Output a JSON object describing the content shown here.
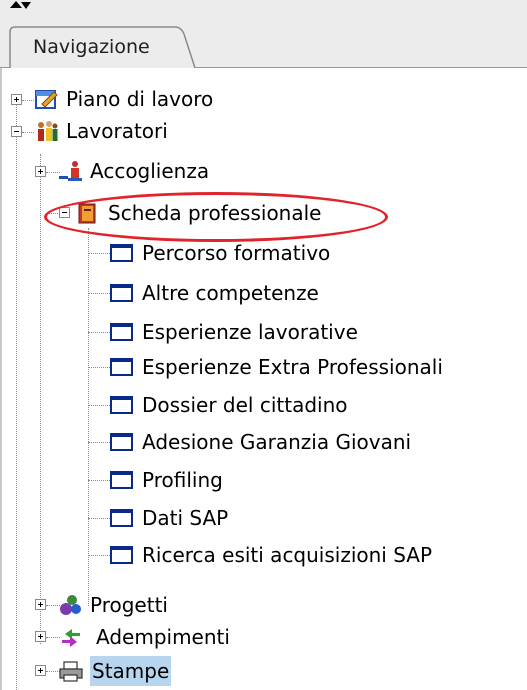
{
  "tab": {
    "label": "Navigazione"
  },
  "tree": {
    "piano": "Piano di lavoro",
    "lavoratori": "Lavoratori",
    "accoglienza": "Accoglienza",
    "scheda": "Scheda professionale",
    "scheda_children": [
      "Percorso formativo",
      "Altre competenze",
      "Esperienze lavorative",
      "Esperienze Extra Professionali",
      "Dossier del cittadino",
      "Adesione Garanzia Giovani",
      "Profiling",
      "Dati SAP",
      "Ricerca esiti acquisizioni SAP"
    ],
    "progetti": "Progetti",
    "adempimenti": "Adempimenti",
    "stampe": "Stampe"
  },
  "colors": {
    "highlight": "#e0242b",
    "selection": "#b8d5ef"
  }
}
